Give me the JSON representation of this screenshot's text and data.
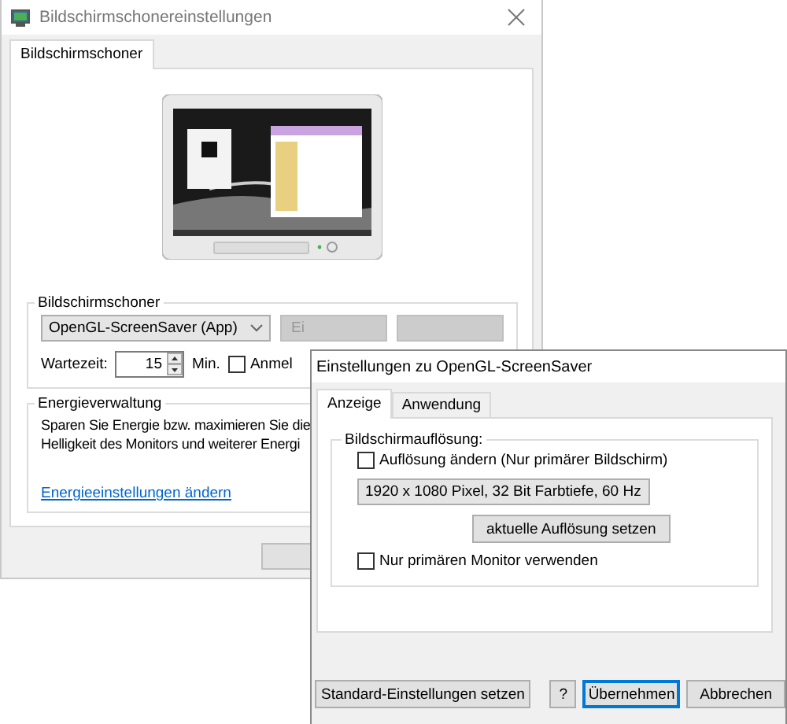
{
  "main_window": {
    "title": "Bildschirmschonereinstellungen",
    "tabs": [
      {
        "label": "Bildschirmschoner",
        "selected": true
      }
    ],
    "screensaver_group": {
      "title": "Bildschirmschoner",
      "selected_screensaver": "OpenGL-ScreenSaver (App)",
      "buttons": [
        {
          "kind": "labeled",
          "label": "Ei"
        },
        {
          "kind": "blank"
        }
      ],
      "wait_label": "Wartezeit:",
      "wait_value": "15",
      "wait_unit": "Min.",
      "logon_checkbox": {
        "label": "Anmel",
        "checked": false
      }
    },
    "power_group": {
      "title": "Energieverwaltung",
      "text_lines": [
        "Sparen Sie Energie bzw. maximieren Sie die",
        "Helligkeit des Monitors und weiterer Energi"
      ],
      "link": "Energieeinstellungen ändern"
    }
  },
  "dialog": {
    "title": "Einstellungen zu OpenGL-ScreenSaver",
    "tabs": [
      {
        "label": "Anzeige",
        "selected": true
      },
      {
        "label": "Anwendung",
        "selected": false
      }
    ],
    "resolution_group": {
      "title": "Bildschirmauflösung:",
      "change_checkbox": {
        "label": "Auflösung ändern (Nur primärer Bildschirm)",
        "checked": false
      },
      "resolution": "1920 x 1080 Pixel, 32 Bit Farbtiefe, 60 Hz",
      "set_current_button": "aktuelle Auflösung setzen",
      "primary_checkbox": {
        "label": "Nur primären Monitor verwenden",
        "checked": false
      }
    },
    "buttons": [
      {
        "label": "Standard-Einstellungen setzen",
        "focused": false
      },
      {
        "label": "?",
        "focused": false
      },
      {
        "label": "Übernehmen",
        "focused": true
      },
      {
        "label": "Abbrechen",
        "focused": false
      }
    ]
  }
}
